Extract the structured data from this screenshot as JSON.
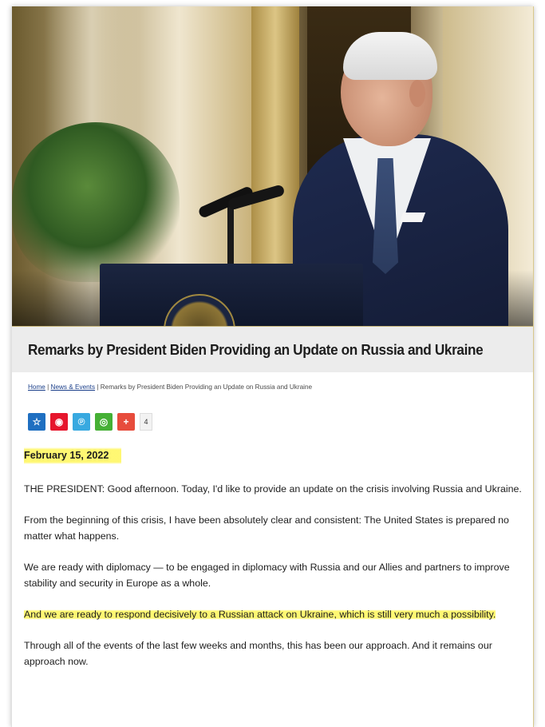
{
  "article": {
    "title": "Remarks by President Biden Providing an Update on Russia and Ukraine",
    "date": "February 15, 2022",
    "paragraphs": [
      "THE PRESIDENT:  Good afternoon.  Today, I'd like to provide an update on the crisis involving Russia and Ukraine.",
      "From the beginning of this crisis, I have been absolutely clear and consistent: The United States is prepared no matter what happens.",
      "We are ready with diplomacy — to be engaged in diplomacy with Russia and our Allies and partners to improve stability and security in Europe as a whole.",
      "And we are ready to respond decisively to a Russian attack on Ukraine, which is still very much a possibility.",
      "Through all of the events of the last few weeks and months, this has been our approach.  And it remains our approach now."
    ]
  },
  "breadcrumb": {
    "home": "Home",
    "sep1": " | ",
    "news": "News & Events",
    "sep2": " | ",
    "current": "Remarks by President Biden Providing an Update on Russia and Ukraine"
  },
  "share": {
    "count": "4",
    "buttons": [
      {
        "icon": "star-bookmark-icon",
        "glyph": "☆",
        "color": "#1f6fc1"
      },
      {
        "icon": "weibo-icon",
        "glyph": "◉",
        "color": "#e6162d"
      },
      {
        "icon": "tencent-weibo-icon",
        "glyph": "℗",
        "color": "#38a9e0"
      },
      {
        "icon": "wechat-icon",
        "glyph": "◎",
        "color": "#45b035"
      },
      {
        "icon": "plus-share-icon",
        "glyph": "+",
        "color": "#e74c3c"
      }
    ]
  },
  "colors": {
    "highlight": "#fff65a",
    "link": "#1b3f8a",
    "title_bar": "#ececec"
  }
}
